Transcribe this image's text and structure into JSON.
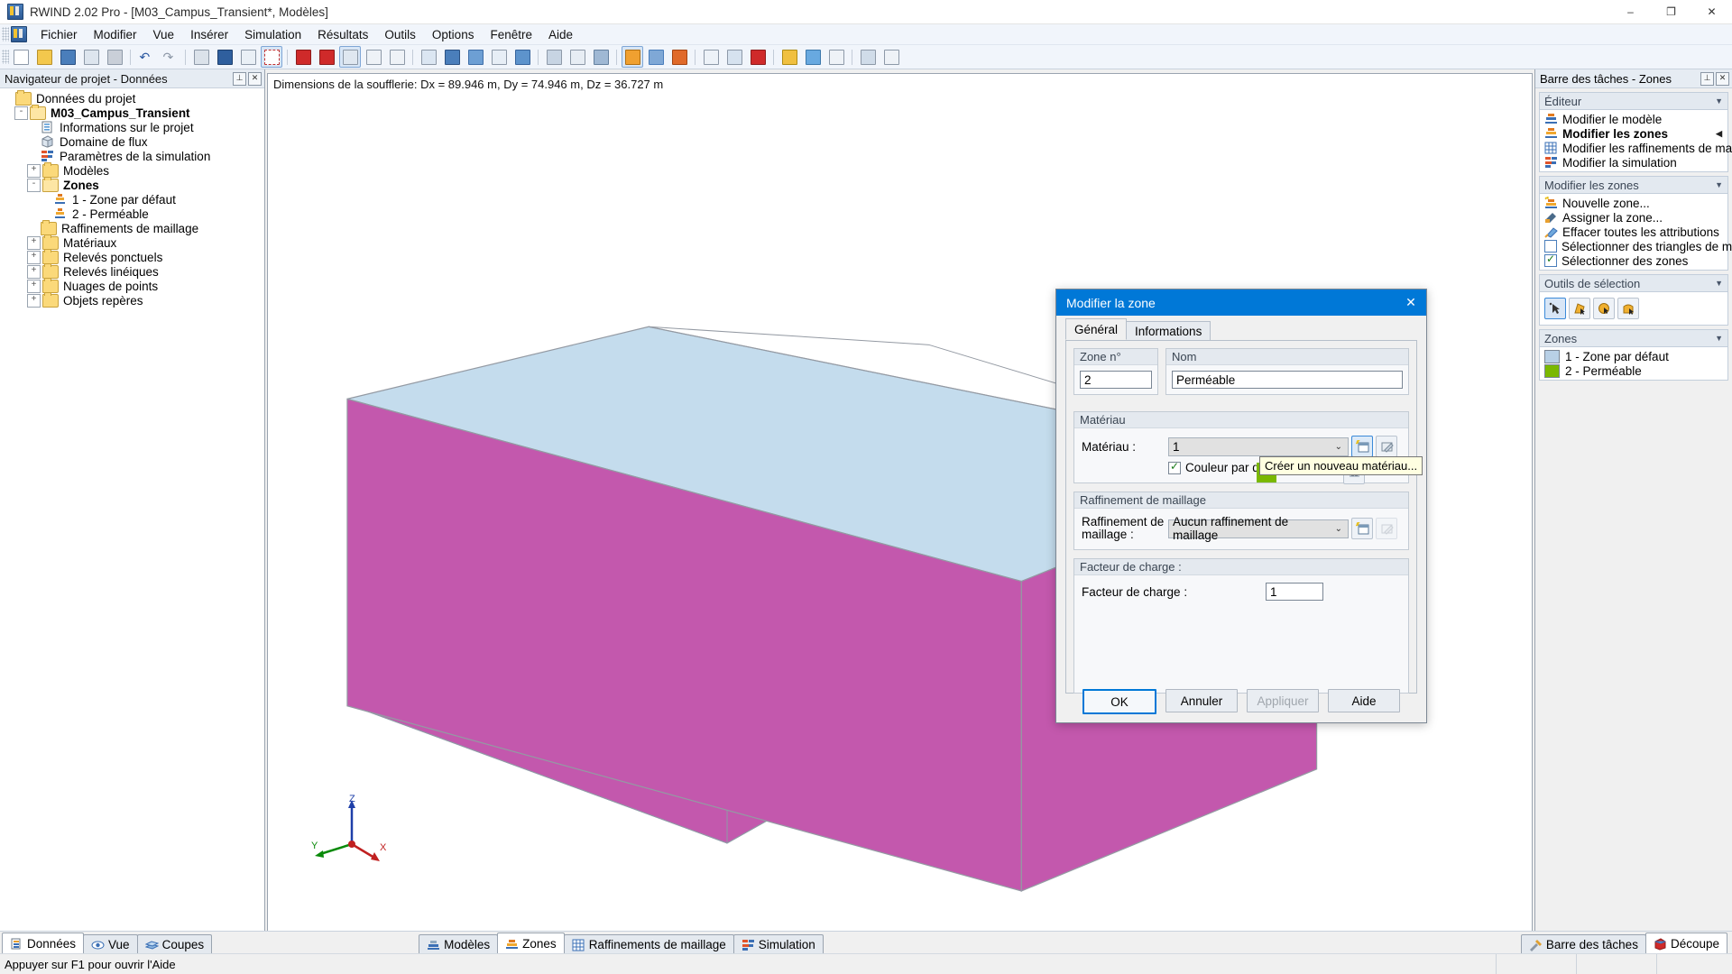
{
  "window": {
    "title": "RWIND 2.02 Pro - [M03_Campus_Transient*, Modèles]",
    "minimize": "‒",
    "maximize": "❐",
    "close": "✕"
  },
  "menu": {
    "items": [
      "Fichier",
      "Modifier",
      "Vue",
      "Insérer",
      "Simulation",
      "Résultats",
      "Outils",
      "Options",
      "Fenêtre",
      "Aide"
    ]
  },
  "navigator": {
    "header": "Navigateur de projet - Données",
    "pin_label": "⊥",
    "close_label": "✕",
    "tree": [
      {
        "label": "Données du projet",
        "depth": 0,
        "icon": "folder",
        "expander": "none",
        "bold": false
      },
      {
        "label": "M03_Campus_Transient",
        "depth": 1,
        "icon": "folder-open",
        "expander": "-",
        "bold": true
      },
      {
        "label": "Informations sur le projet",
        "depth": 2,
        "icon": "info",
        "expander": "none",
        "bold": false
      },
      {
        "label": "Domaine de flux",
        "depth": 2,
        "icon": "cube",
        "expander": "none",
        "bold": false
      },
      {
        "label": "Paramètres de la simulation",
        "depth": 2,
        "icon": "sim",
        "expander": "none",
        "bold": false
      },
      {
        "label": "Modèles",
        "depth": 2,
        "icon": "folder",
        "expander": "+",
        "bold": false
      },
      {
        "label": "Zones",
        "depth": 2,
        "icon": "folder-open",
        "expander": "-",
        "bold": true
      },
      {
        "label": "1 - Zone par défaut",
        "depth": 3,
        "icon": "zone",
        "expander": "none",
        "bold": false
      },
      {
        "label": "2 - Perméable",
        "depth": 3,
        "icon": "zone",
        "expander": "none",
        "bold": false
      },
      {
        "label": "Raffinements de maillage",
        "depth": 2,
        "icon": "folder",
        "expander": "none",
        "bold": false
      },
      {
        "label": "Matériaux",
        "depth": 2,
        "icon": "folder",
        "expander": "+",
        "bold": false
      },
      {
        "label": "Relevés ponctuels",
        "depth": 2,
        "icon": "folder",
        "expander": "+",
        "bold": false
      },
      {
        "label": "Relevés linéiques",
        "depth": 2,
        "icon": "folder",
        "expander": "+",
        "bold": false
      },
      {
        "label": "Nuages de points",
        "depth": 2,
        "icon": "folder",
        "expander": "+",
        "bold": false
      },
      {
        "label": "Objets repères",
        "depth": 2,
        "icon": "folder",
        "expander": "+",
        "bold": false
      }
    ]
  },
  "viewport": {
    "dimensions_text": "Dimensions de la soufflerie: Dx = 89.946 m, Dy = 74.946 m, Dz = 36.727 m",
    "axis": {
      "x": "X",
      "y": "Y",
      "z": "Z"
    },
    "colors": {
      "face_magenta": "#c256ab",
      "face_magenta_dark": "#bb4ea5",
      "face_blue": "#c3dced",
      "face_blue_dark": "#b4d4e8",
      "edge": "#8f8f9a"
    }
  },
  "dialog": {
    "title": "Modifier la zone",
    "close_label": "✕",
    "tabs": [
      {
        "label": "Général",
        "active": true
      },
      {
        "label": "Informations",
        "active": false
      }
    ],
    "zone_number": {
      "legend": "Zone n°",
      "value": "2"
    },
    "name": {
      "legend": "Nom",
      "value": "Perméable"
    },
    "material": {
      "legend": "Matériau",
      "label": "Matériau :",
      "value": "1",
      "default_color_label": "Couleur par défaut",
      "default_color_checked": true,
      "new_button_icon": "new-material-icon",
      "edit_button_icon": "edit-material-icon"
    },
    "mesh_refinement": {
      "legend": "Raffinement de maillage",
      "label": "Raffinement de maillage :",
      "value": "Aucun raffinement de maillage",
      "new_button_icon": "new-refinement-icon",
      "edit_button_icon": "edit-refinement-icon"
    },
    "load_factor": {
      "legend": "Facteur de charge :",
      "label": "Facteur de charge :",
      "value": "1"
    },
    "tooltip": "Créer un nouveau matériau...",
    "buttons": [
      {
        "label": "OK",
        "style": "default"
      },
      {
        "label": "Annuler",
        "style": "normal"
      },
      {
        "label": "Appliquer",
        "style": "disabled"
      },
      {
        "label": "Aide",
        "style": "normal"
      }
    ]
  },
  "taskbar": {
    "header": "Barre des tâches - Zones",
    "pin_label": "⊥",
    "close_label": "✕",
    "groups": [
      {
        "title": "Éditeur",
        "items": [
          {
            "label": "Modifier le modèle",
            "icon": "zone-icon",
            "bold": false,
            "arrow": false
          },
          {
            "label": "Modifier les zones",
            "icon": "zone-icon",
            "bold": true,
            "arrow": true
          },
          {
            "label": "Modifier les raffinements de maill...",
            "icon": "grid-icon",
            "bold": false,
            "arrow": false
          },
          {
            "label": "Modifier la simulation",
            "icon": "sim-icon",
            "bold": false,
            "arrow": false
          }
        ]
      },
      {
        "title": "Modifier les zones",
        "items": [
          {
            "label": "Nouvelle zone...",
            "icon": "new-zone-icon",
            "bold": false,
            "arrow": false
          },
          {
            "label": "Assigner la zone...",
            "icon": "assign-icon",
            "bold": false,
            "arrow": false
          },
          {
            "label": "Effacer toutes les attributions",
            "icon": "eraser-icon",
            "bold": false,
            "arrow": false
          },
          {
            "label": "Sélectionner des triangles de mai...",
            "icon": "checkbox-unchecked-icon",
            "bold": false,
            "arrow": false,
            "checkbox": "unchecked"
          },
          {
            "label": "Sélectionner des zones",
            "icon": "checkbox-checked-icon",
            "bold": false,
            "arrow": false,
            "checkbox": "checked"
          }
        ]
      }
    ],
    "selection_tools": {
      "title": "Outils de sélection",
      "buttons": [
        "pointer-select-icon",
        "polygon-select-icon",
        "circle-select-icon",
        "freehand-select-icon"
      ]
    },
    "zones": {
      "title": "Zones",
      "items": [
        {
          "label": "1 - Zone par défaut",
          "color": "#b8d0e6"
        },
        {
          "label": "2 - Perméable",
          "color": "#7ab800"
        }
      ]
    }
  },
  "bottom_tabs": {
    "left": [
      {
        "label": "Données",
        "icon": "data-icon",
        "active": true
      },
      {
        "label": "Vue",
        "icon": "eye-icon",
        "active": false
      },
      {
        "label": "Coupes",
        "icon": "sections-icon",
        "active": false
      }
    ],
    "center": [
      {
        "label": "Modèles",
        "icon": "models-icon",
        "active": false
      },
      {
        "label": "Zones",
        "icon": "zones-icon",
        "active": true
      },
      {
        "label": "Raffinements de maillage",
        "icon": "refinement-icon",
        "active": false
      },
      {
        "label": "Simulation",
        "icon": "simulation-icon",
        "active": false
      }
    ],
    "right": [
      {
        "label": "Barre des tâches",
        "icon": "tools-icon",
        "active": false
      },
      {
        "label": "Découpe",
        "icon": "clip-icon",
        "active": true
      }
    ]
  },
  "statusbar": {
    "message": "Appuyer sur F1 pour ouvrir l'Aide"
  }
}
